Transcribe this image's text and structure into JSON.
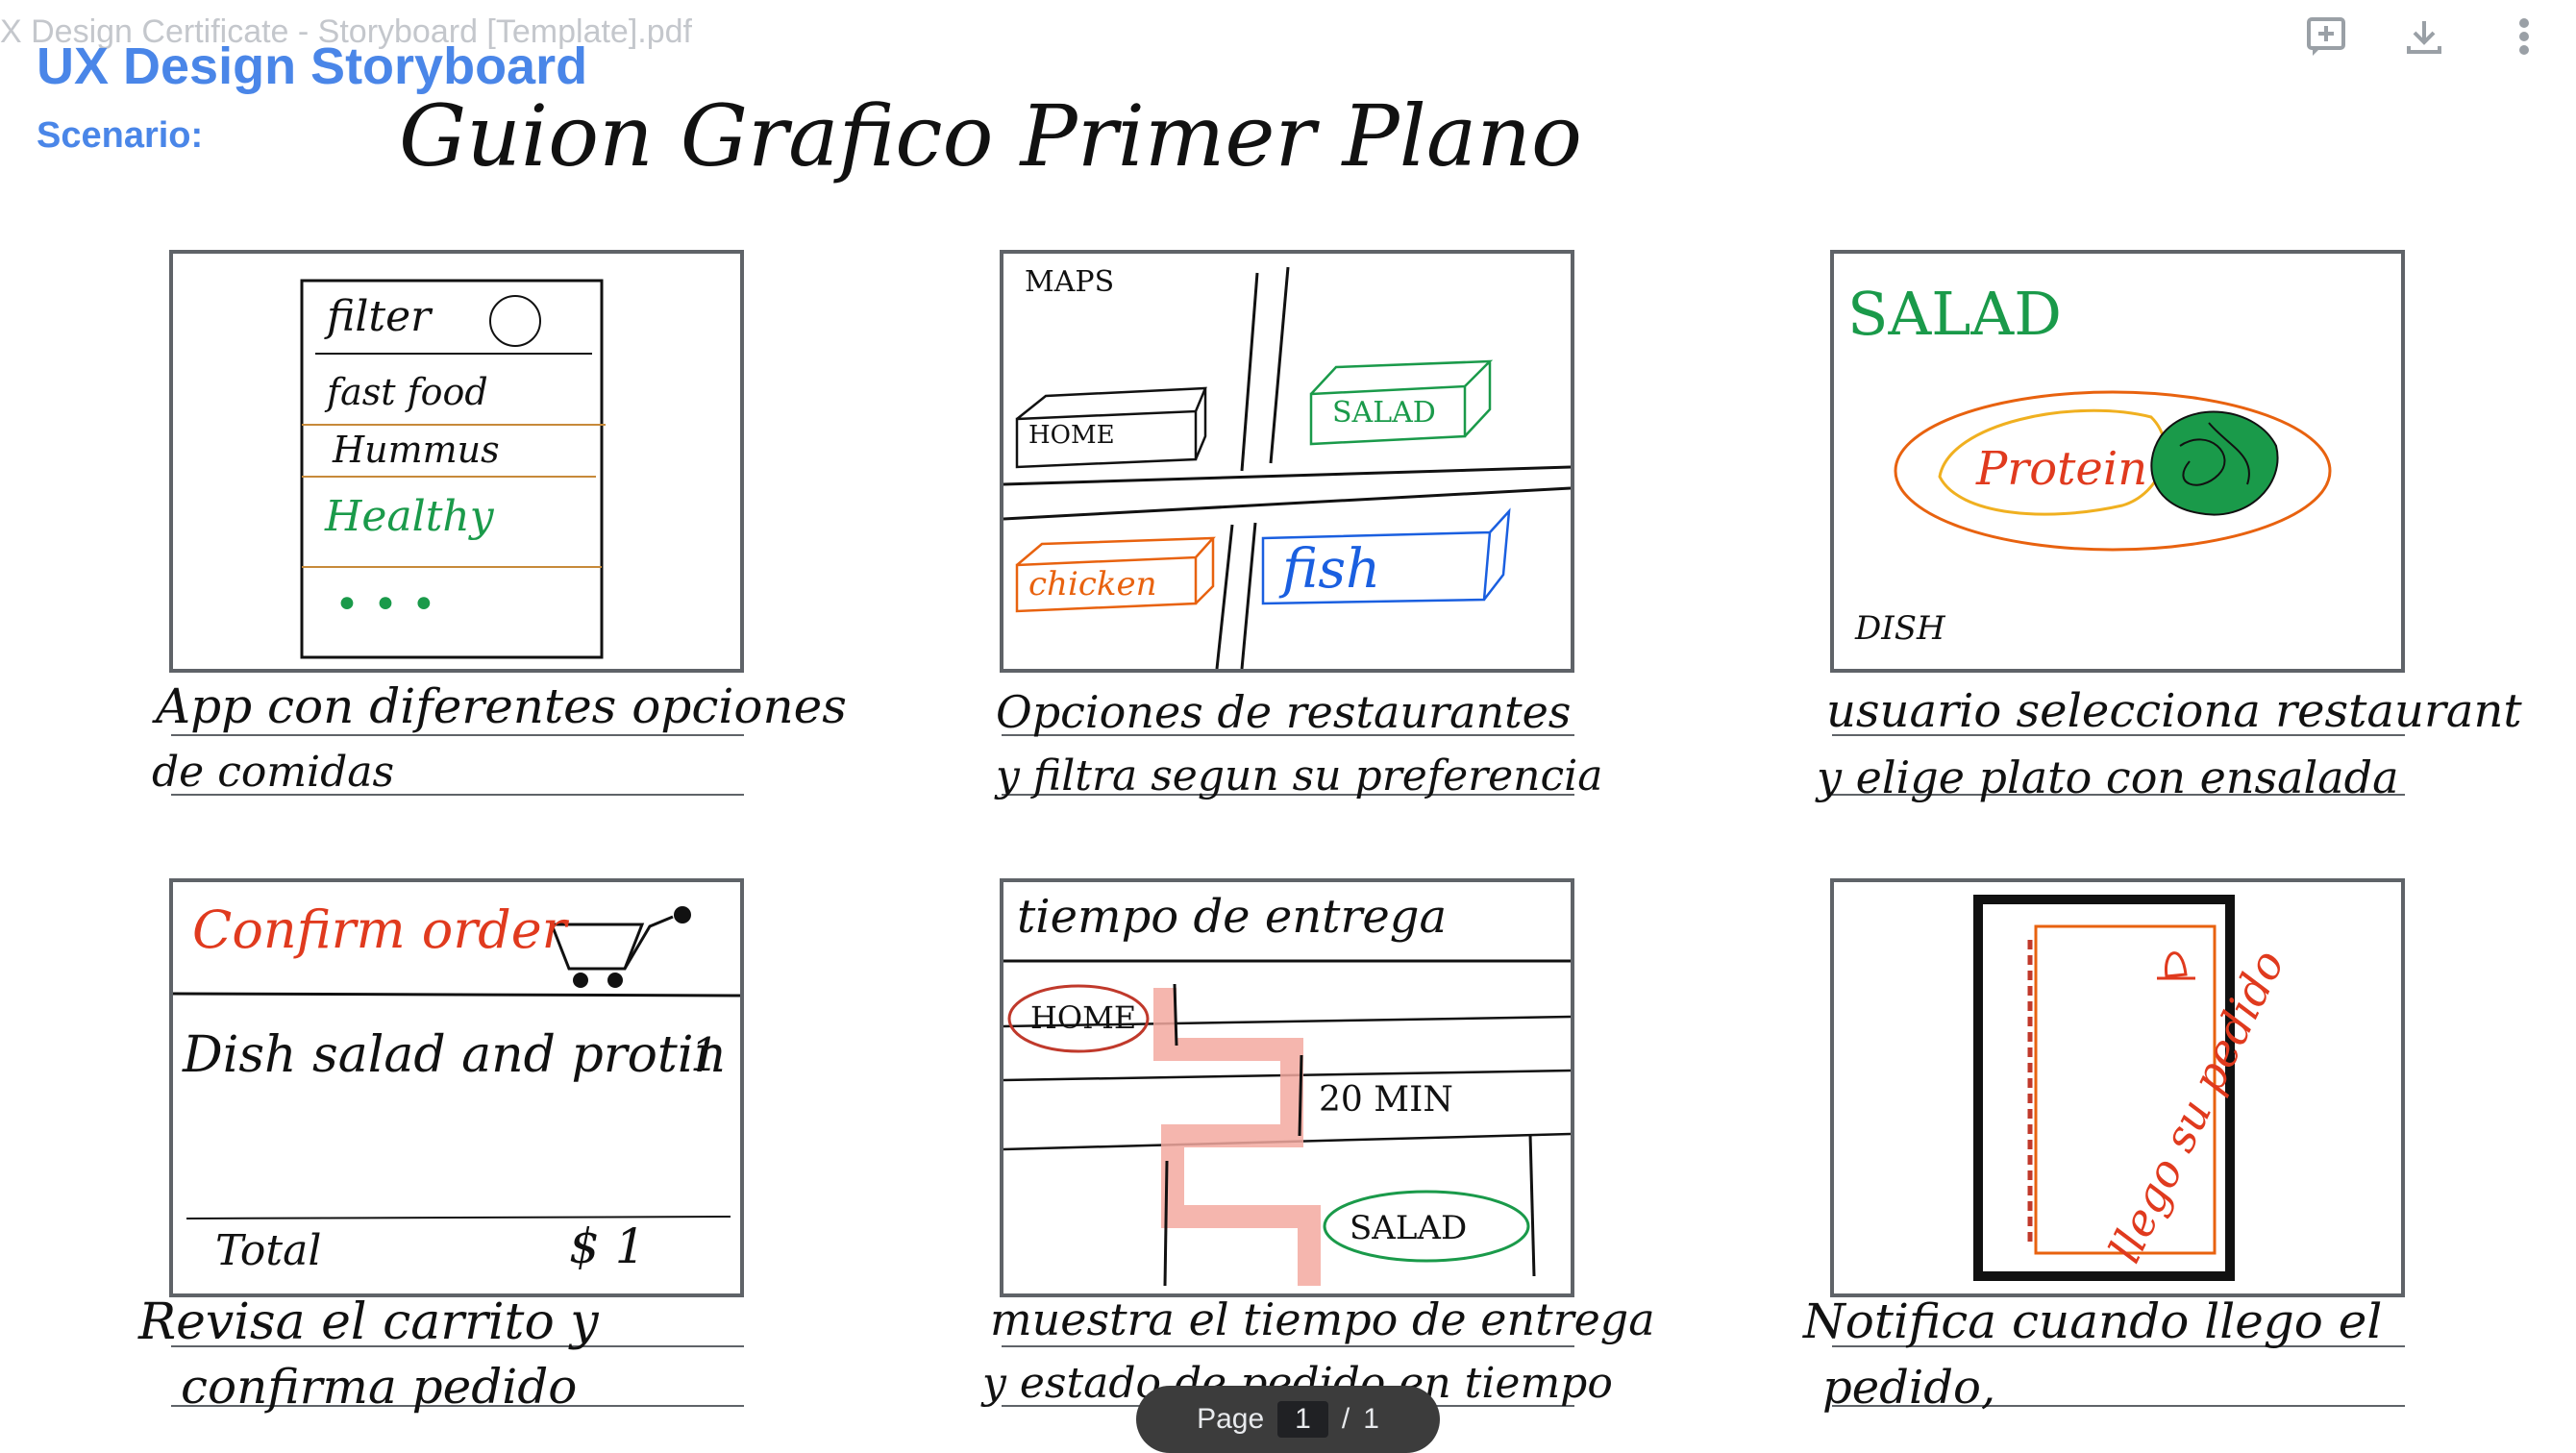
{
  "viewer": {
    "filename": "X Design Certificate - Storyboard [Template].pdf",
    "icons": [
      "add-comment-icon",
      "download-icon",
      "more-vert-icon"
    ],
    "page_label": "Page",
    "current_page": "1",
    "separator": "/",
    "total_pages": "1"
  },
  "document": {
    "title": "UX Design Storyboard",
    "scenario_label": "Scenario:",
    "scenario_value": "Guion Grafico Primer Plano"
  },
  "panels": [
    {
      "texts": [
        "filter",
        "fast food",
        "Hummus",
        "Healthy",
        "• • •"
      ],
      "caption": [
        "App con diferentes opciones",
        "de comidas"
      ]
    },
    {
      "texts": [
        "MAPS",
        "HOME",
        "SALAD",
        "chicken",
        "fish"
      ],
      "caption": [
        "Opciones de restaurantes",
        "y filtra segun su preferencia"
      ]
    },
    {
      "texts": [
        "SALAD",
        "Protein",
        "DISH"
      ],
      "caption": [
        "usuario selecciona restaurant",
        "y elige plato con ensalada"
      ]
    },
    {
      "texts": [
        "Confirm order",
        "Dish salad and protin",
        "1",
        "Total",
        "$ 1"
      ],
      "caption": [
        "Revisa el carrito y",
        "confirma pedido"
      ]
    },
    {
      "texts": [
        "tiempo de entrega",
        "HOME",
        "20 MIN",
        "SALAD"
      ],
      "caption": [
        "muestra el tiempo de entrega",
        "y estado de pedido en tiempo"
      ]
    },
    {
      "texts": [
        "llego su pedido"
      ],
      "caption": [
        "Notifica cuando llego el",
        "pedido,"
      ]
    }
  ],
  "colors": {
    "accent_blue": "#4a86e8",
    "panel_border": "#5f6368",
    "sketch_green": "#1a9a4a",
    "sketch_orange": "#e8620f",
    "sketch_blue": "#1a5fe0",
    "sketch_red": "#e03a1e",
    "path_pink": "#f3a9a0"
  }
}
